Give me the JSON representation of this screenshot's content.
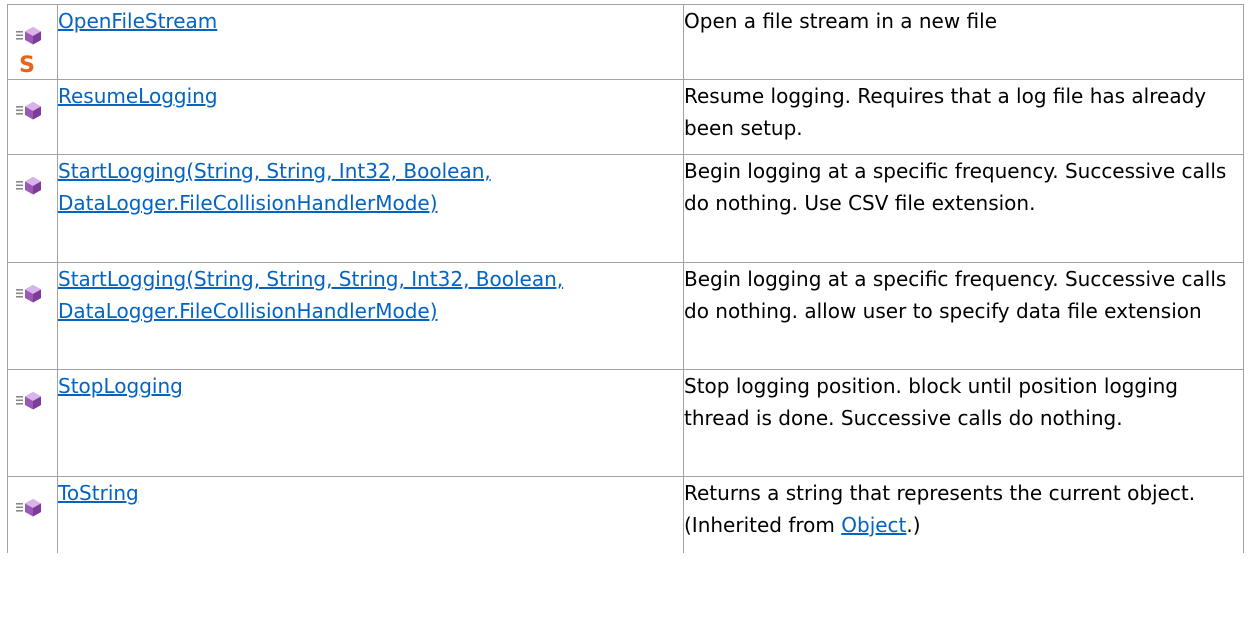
{
  "colors": {
    "link": "#0563c1",
    "border": "#a3a3a3",
    "method_icon": "#9b59b6",
    "static_icon": "#e8641b"
  },
  "members": [
    {
      "icon": "public-method-icon",
      "static_icon": "static-icon",
      "static_glyph": "S",
      "name": "OpenFileStream",
      "description": "Open a file stream in a new file"
    },
    {
      "icon": "public-method-icon",
      "name": "ResumeLogging",
      "description": "Resume logging. Requires that a log file has already been setup."
    },
    {
      "icon": "public-method-icon",
      "name": "StartLogging(String, String, Int32, Boolean, DataLogger.FileCollisionHandlerMode)",
      "description": "Begin logging at a specific frequency. Successive calls do nothing. Use CSV file extension."
    },
    {
      "icon": "public-method-icon",
      "name": "StartLogging(String, String, String, Int32, Boolean, DataLogger.FileCollisionHandlerMode)",
      "description": "Begin logging at a specific frequency. Successive calls do nothing. allow user to specify data file extension"
    },
    {
      "icon": "public-method-icon",
      "name": "StopLogging",
      "description": "Stop logging position. block until position logging thread is done. Successive calls do nothing."
    },
    {
      "icon": "public-method-icon",
      "name": "ToString",
      "description_prefix": "Returns a string that represents the current object. (Inherited from ",
      "description_link": "Object",
      "description_suffix": ".)"
    }
  ]
}
